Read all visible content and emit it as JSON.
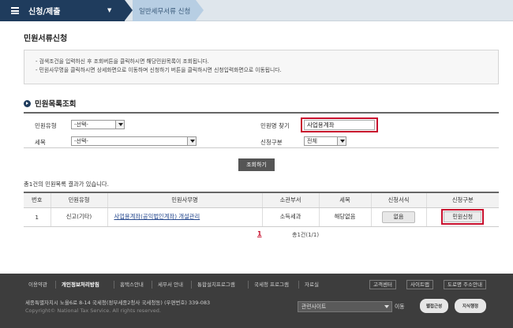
{
  "nav": {
    "menu_label": "신청/제출",
    "breadcrumb": "일반세무서류 신청"
  },
  "page": {
    "title": "민원서류신청"
  },
  "notice": {
    "lines": [
      "- 검색조건을 입력하신 후 조회버튼을 클릭하시면 해당민원목록이 조회됩니다.",
      "- 민원사무명을 클릭하시면 상세화면으로 이동하며  신청하기 버튼을 클릭하시면 신청입력화면으로 이동됩니다."
    ]
  },
  "search": {
    "section_title": "민원목록조회",
    "type_label": "민원유형",
    "type_value": "-선택-",
    "tax_label": "세목",
    "tax_value": "-선택-",
    "name_label": "민원명 찾기",
    "name_value": "사업용계좌",
    "category_label": "신청구분",
    "category_value": "전체",
    "search_button": "조회하기"
  },
  "results": {
    "count_text": "총1건의 민원목록 결과가 있습니다.",
    "columns": [
      "번호",
      "민원유형",
      "민원사무명",
      "소관부서",
      "세목",
      "신청서식",
      "신청구분"
    ],
    "rows": [
      {
        "no": "1",
        "type": "신고(기타)",
        "name": "사업용계좌(공익법인계좌) 개설관리",
        "dept": "소득세과",
        "tax": "해당없음",
        "form": "없음",
        "apply": "민원신청"
      }
    ]
  },
  "pager": {
    "current": "1",
    "info": "총1건(1/1)"
  },
  "footer": {
    "links": [
      "이용약관",
      "개인정보처리방침",
      "홈택스안내",
      "세무서 안내",
      "통합설치프로그램",
      "국세청 프로그램",
      "자료실"
    ],
    "right_buttons": [
      "고객센터",
      "사이트맵",
      "도로명 주소안내"
    ],
    "address": "세종특별자치시 노을6로 8-14 국세청(정부세종2청사 국세청동) (우편번호) 339-083",
    "copyright": "Copyright© National Tax Service. All rights reserved.",
    "related_sites": "관련사이트",
    "go": "이동",
    "badges": [
      "웹접근성",
      "지식행정"
    ]
  }
}
